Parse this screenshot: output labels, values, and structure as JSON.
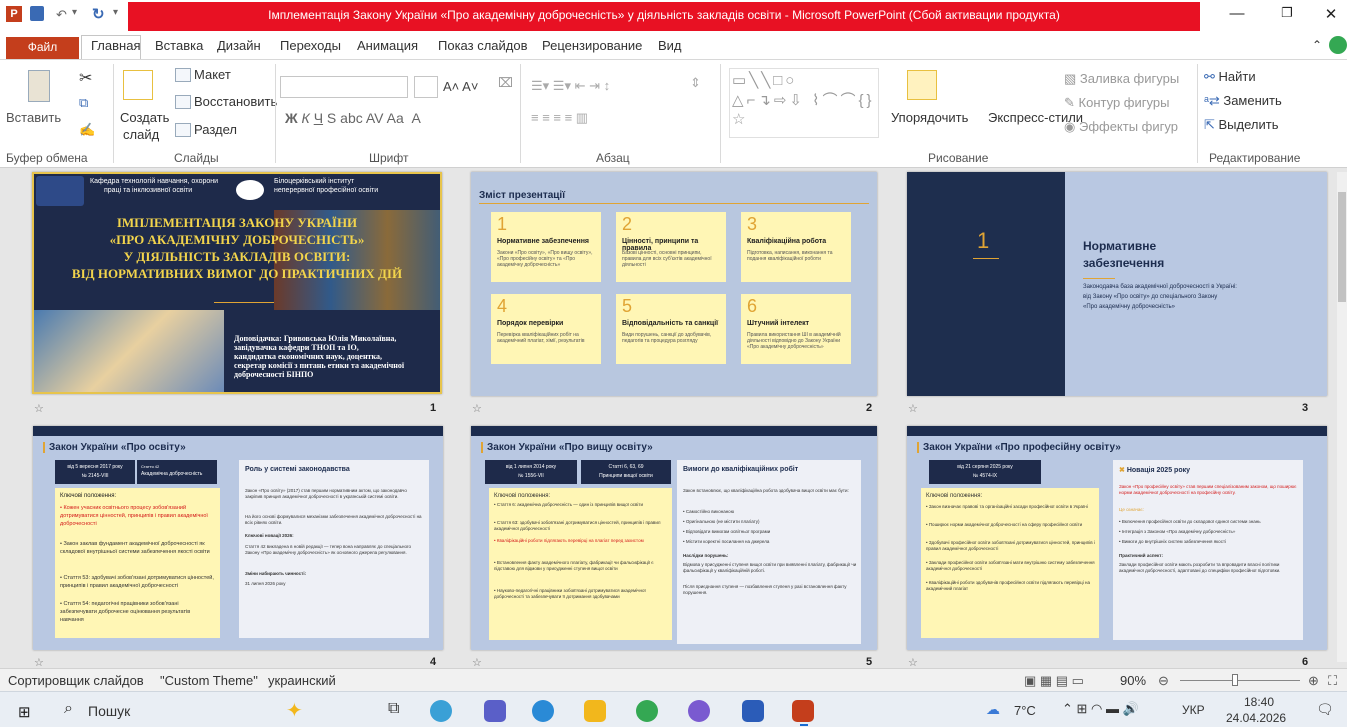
{
  "window": {
    "title": "Імплементація Закону України «Про академічну доброчесність» у діяльність закладів освіти  -  Microsoft PowerPoint (Сбой активации продукта)"
  },
  "tabs": [
    "Файл",
    "Главная",
    "Вставка",
    "Дизайн",
    "Переходы",
    "Анимация",
    "Показ слайдов",
    "Рецензирование",
    "Вид"
  ],
  "ribbon": {
    "paste": "Вставить",
    "layout": "Макет",
    "restore": "Восстановить",
    "create": "Создать",
    "create2": "слайд",
    "section": "Раздел",
    "arrange": "Упорядочить",
    "styles": "Экспресс-стили",
    "fill": "Заливка фигуры",
    "outline": "Контур фигуры",
    "effects": "Эффекты фигур",
    "find": "Найти",
    "replace": "Заменить",
    "select": "Выделить",
    "groups": [
      "Буфер обмена",
      "Слайды",
      "Шрифт",
      "Абзац",
      "Рисование",
      "Редактирование"
    ]
  },
  "slides": {
    "s1": {
      "org1a": "Кафедра технологій навчання, охорони",
      "org1b": "праці та інклюзивної освіти",
      "org2a": "Білоцерківський інститут",
      "org2b": "неперервної професійної освіти",
      "t1": "ІМПЛЕМЕНТАЦІЯ ЗАКОНУ УКРАЇНИ",
      "t2": "«ПРО АКАДЕМІЧНУ ДОБРОЧЕСНІСТЬ»",
      "t3": "У ДІЯЛЬНІСТЬ ЗАКЛАДІВ ОСВІТИ:",
      "t4": "ВІД НОРМАТИВНИХ ВИМОГ ДО ПРАКТИЧНИХ ДІЙ",
      "sp1": "Доповідачка: Гривовська  Юлія Миколаївна,",
      "sp2": "завідувачка кафедри ТНОП та ІО,",
      "sp3": "кандидатка економічних наук, доцентка,",
      "sp4": "секретар комісії з питань етики та академічної",
      "sp5": "доброчесності БІНПО",
      "num": "1"
    },
    "s2": {
      "title": "Зміст презентації",
      "num": "2",
      "cards": [
        {
          "n": "1",
          "t": "Нормативне забезпечення",
          "d": "Закони «Про освіту», «Про вищу освіту», «Про професійну освіту» та «Про академічну доброчесність»"
        },
        {
          "n": "2",
          "t": "Цінності, принципи та правила",
          "d": "Базові цінності, основні принципи, правила для всіх суб'єктів академічної діяльності"
        },
        {
          "n": "3",
          "t": "Кваліфікаційна робота",
          "d": "Підготовка, написання, виконання та подання кваліфікаційної роботи"
        },
        {
          "n": "4",
          "t": "Порядок перевірки",
          "d": "Перевірка кваліфікаційних робіт на академічний плагіат, хімії, результатів"
        },
        {
          "n": "5",
          "t": "Відповідальність та санкції",
          "d": "Види порушень, санкції до здобувачів, педагогів та процедура розгляду"
        },
        {
          "n": "6",
          "t": "Штучний інтелект",
          "d": "Правила використання ШІ в академічній діяльності відповідно до Закону України «Про академічну доброчесність»"
        }
      ]
    },
    "s3": {
      "big": "1",
      "h1": "Нормативне",
      "h2": "забезпечення",
      "p1": "Законодавча база академічної доброчесності в Україні:",
      "p2": "від Закону «Про освіту» до спеціального Закону",
      "p3": "«Про академічну доброчесність»",
      "num": "3"
    },
    "s4": {
      "title": "Закон України «Про освіту»",
      "date": "від 5 вересня 2017 року",
      "law": "№ 2145-VIII",
      "art": "Стаття 42",
      "artd": "Академічна доброчесність",
      "box": "Роль у системі законодавства",
      "kp": "Ключові положення:",
      "l1": "• Кожен учасник освітнього процесу зобов'язаний дотримуватися цінностей, принципів і правил академічної доброчесності",
      "l2": "• Закон заклав фундамент академічної доброчесності як складової внутрішньої системи забезпечення якості освіти",
      "l3": "• Стаття 53: здобувачі зобов'язані дотримуватися цінностей, принципів і правил академічної доброчесності",
      "l4": "• Стаття 54: педагогічні працівники зобов'язані забезпечувати доброчесне оцінювання результатів навчання",
      "r1": "Закон «Про освіту» (2017) став першим нормативним актом, що законодавчо закріпив принцип академічної доброчесності в українській системі освіти.",
      "r2": "На його основі формувалися механізми забезпечення академічної доброчесності на всіх рівнях освіти.",
      "r3": "Ключові новації 2026:",
      "r4": "Стаття 42 викладена в новій редакції — тепер вона направляє до спеціального Закону «Про академічну доброчесність» як основного джерела регулювання.",
      "r5": "Зміни набирають чинності:",
      "r6": "31 липня 2026 року",
      "num": "4"
    },
    "s5": {
      "title": "Закон України «Про вищу освіту»",
      "date": "від 1 липня 2014 року",
      "law": "№ 1556-VII",
      "art": "Статті 6, 63, 69",
      "artd": "Принципи вищої освіти",
      "box": "Вимоги до кваліфікаційних робіт",
      "kp": "Ключові положення:",
      "l1": "• Стаття 6: академічна доброчесність — один із принципів вищої освіти",
      "l2": "• Стаття 63: здобувачі зобов'язані дотримуватися цінностей, принципів і правил академічної доброчесності",
      "l3": "• Кваліфікаційні роботи підлягають перевірці на плагіат перед захистом",
      "l4": "• Встановлення факту академічного плагіату, фабрикації чи фальсифікації є підставою для відмови у присудженні ступеня вищої освіти",
      "l5": "• Науково-педагогічні працівники зобов'язані дотримуватися академічної доброчесності та забезпечувати її дотримання здобувачами",
      "r1": "Закон встановлює, що кваліфікаційна робота здобувача вищої освіти має бути:",
      "r2": "• Самостійно виконаною",
      "r3": "• Оригінальною (не містити плагіату)",
      "r4": "• Відповідати вимогам освітньої програми",
      "r5": "• Містити коректні посилання на джерела",
      "r6": "Наслідки порушень:",
      "r7": "Відмова у присудженні ступеня вищої освіти при виявленні плагіату, фабрикації чи фальсифікації у кваліфікаційній роботі.",
      "r8": "Після приєднання ступеня — позбавлення ступеня у разі встановлення факту порушення.",
      "num": "5"
    },
    "s6": {
      "title": "Закон України «Про професійну освіту»",
      "date": "від 21 серпня 2025 року",
      "law": "№ 4574-IX",
      "box": "Новація 2025 року",
      "kp": "Ключові положення:",
      "l1": "• Закон визначає правові та організаційні засади професійної освіти в Україні",
      "l2": "• Поширює норми академічної доброчесності на сферу професійної освіти",
      "l3": "• Здобувачі професійної освіти зобов'язані дотримуватися цінностей, принципів і правил академічної доброчесності",
      "l4": "• Заклади професійної освіти зобов'язані мати внутрішню систему забезпечення академічної доброчесності",
      "l5": "• Кваліфікаційні роботи здобувачів професійної освіти підлягають перевірці на академічний плагіат",
      "r1": "Закон «Про професійну освіту» став першим спеціалізованим законом, що поширює норми академічної доброчесності на професійну освіту.",
      "r2": "Це означає:",
      "r3": "• Включення професійної освіти до складової єдиної системи знань",
      "r4": "• Інтеграція з Законом «Про академічну доброчесність»",
      "r5": "• Вимоги до внутрішніх систем забезпечення якості",
      "r6": "Практичний аспект:",
      "r7": "Заклади професійної освіти мають розробити та впровадити власні політики академічної доброчесності, адаптовані до специфіки професійної підготовки.",
      "num": "6"
    }
  },
  "status": {
    "sorter": "Сортировщик слайдов",
    "theme": "\"Custom Theme\"",
    "lang": "украинский",
    "zoom": "90%"
  },
  "taskbar": {
    "search": "Пошук",
    "temp": "7°C",
    "lang": "УКР",
    "time": "18:40",
    "date": "24.04.2026"
  }
}
